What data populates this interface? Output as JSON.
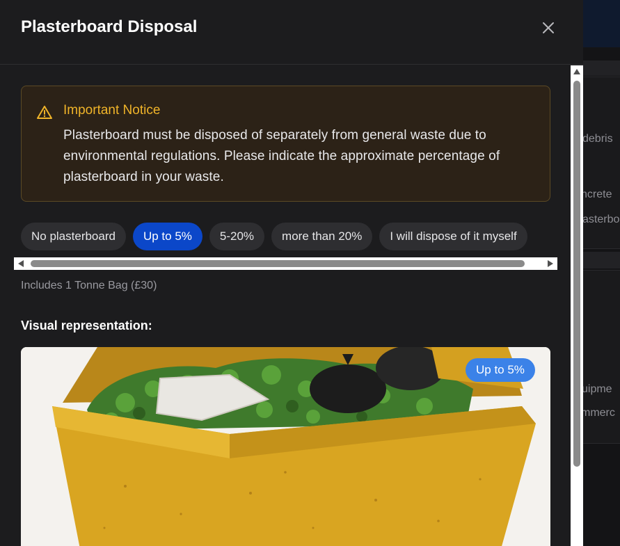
{
  "modal": {
    "title": "Plasterboard Disposal",
    "close_icon": "close-icon"
  },
  "notice": {
    "icon": "warning-triangle-icon",
    "title": "Important Notice",
    "body": "Plasterboard must be disposed of separately from general waste due to environmental regulations. Please indicate the approximate percentage of plasterboard in your waste."
  },
  "options": [
    {
      "label": "No plasterboard",
      "selected": false
    },
    {
      "label": "Up to 5%",
      "selected": true
    },
    {
      "label": "5-20%",
      "selected": false
    },
    {
      "label": "more than 20%",
      "selected": false
    },
    {
      "label": "I will dispose of it myself",
      "selected": false
    }
  ],
  "includes_text": "Includes 1 Tonne Bag (£30)",
  "visual": {
    "label": "Visual representation:",
    "badge": "Up to 5%"
  },
  "background_page": {
    "fragments": [
      "debris",
      "ncrete",
      "asterbo",
      "uipme",
      "mmerc"
    ]
  },
  "colors": {
    "accent": "#0b47c9",
    "badge": "#3b82e8",
    "notice_title": "#f0b429",
    "skip_yellow": "#d9a521"
  }
}
